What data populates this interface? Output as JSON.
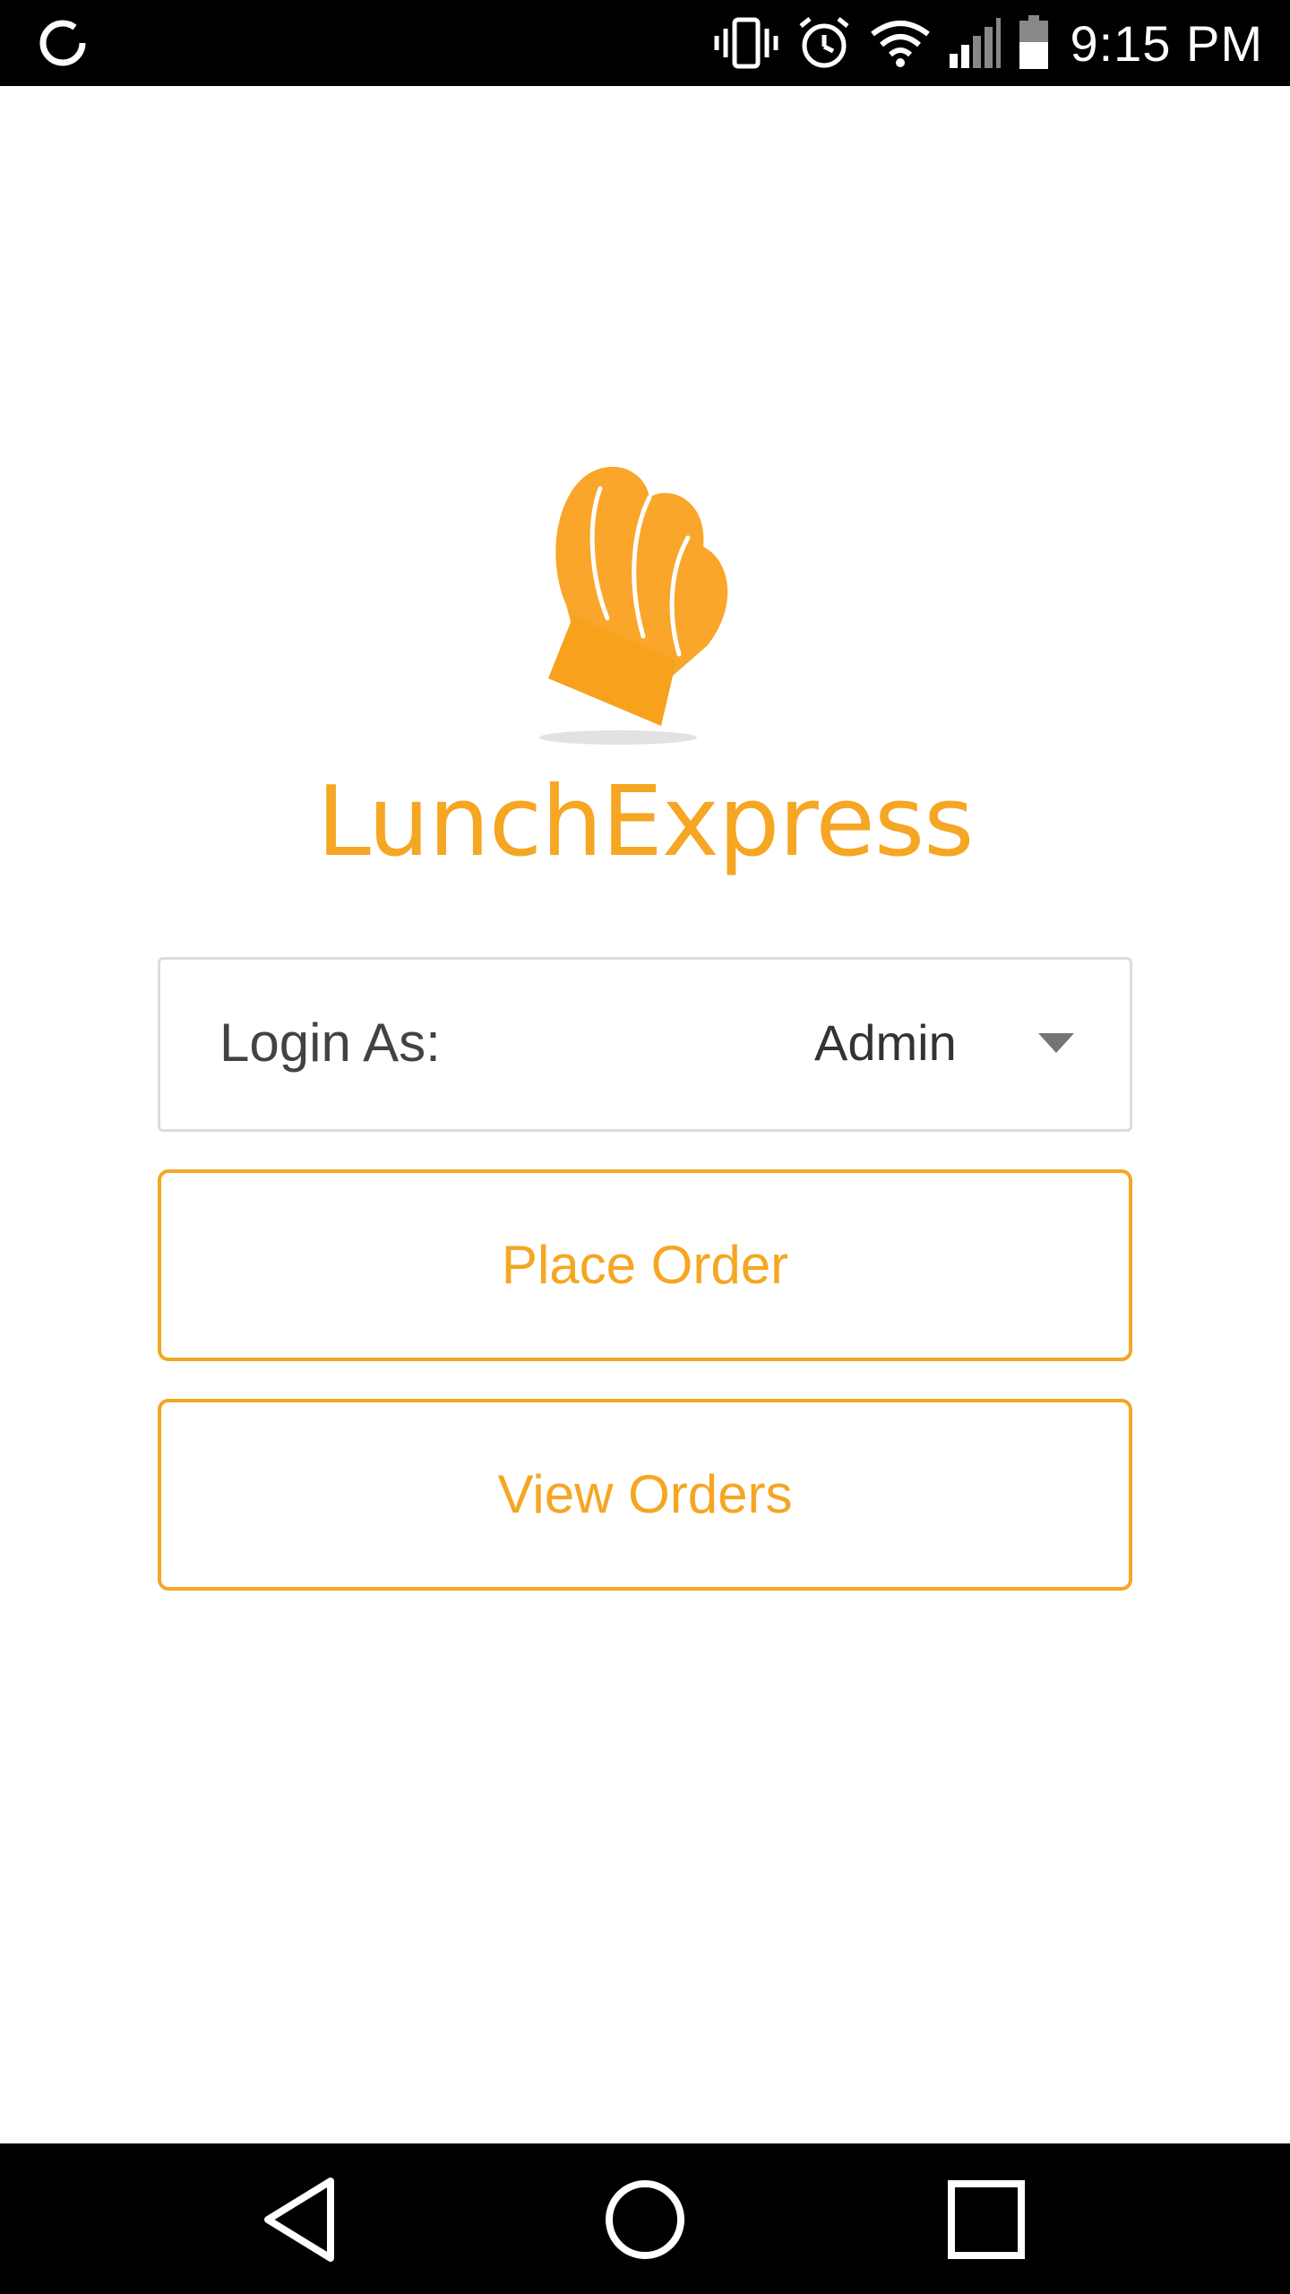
{
  "status_bar": {
    "time": "9:15 PM",
    "icons": [
      "sync-icon",
      "vibrate-icon",
      "alarm-icon",
      "wifi-icon",
      "signal-icon",
      "battery-icon"
    ]
  },
  "app": {
    "brand_name": "LunchExpress",
    "logo_icon": "chef-hat-icon",
    "brand_color": "#f5a623"
  },
  "login": {
    "label": "Login As:",
    "selected_value": "Admin"
  },
  "buttons": {
    "place_order": "Place Order",
    "view_orders": "View Orders"
  },
  "nav_bar": {
    "icons": [
      "back-icon",
      "home-icon",
      "recents-icon"
    ]
  }
}
